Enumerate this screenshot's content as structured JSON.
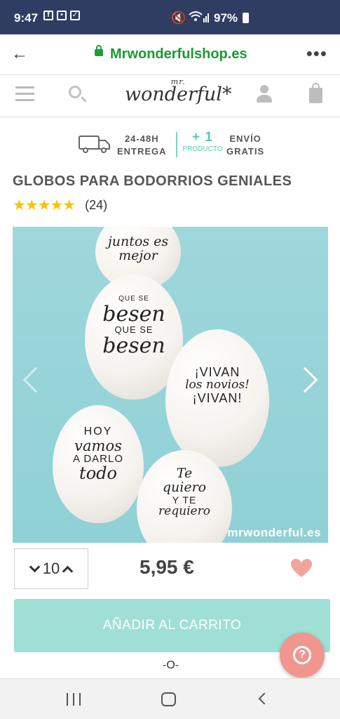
{
  "status_bar": {
    "time": "9:47",
    "battery": "97%"
  },
  "browser": {
    "url": "Mrwonderfulshop.es",
    "more": "•••"
  },
  "site": {
    "logo_top": "mr.",
    "logo_main": "wonderful*"
  },
  "shipping": {
    "delivery_line1": "24-48H",
    "delivery_line2": "ENTREGA",
    "plus": "+ 1",
    "plus_sub": "PRODUCTO",
    "free_line1": "ENVÍO",
    "free_line2": "GRATIS"
  },
  "product": {
    "title": "GLOBOS PARA BODORRIOS GENIALES",
    "stars": "★★★★★",
    "reviews": "(24)",
    "quantity": "10",
    "price": "5,95 €",
    "add_to_cart": "AÑADIR AL CARRITO",
    "separator": "-O-"
  },
  "image": {
    "watermark": "mrwonderful.es",
    "balloon1": "juntos es mejor",
    "balloon2_a": "QUE SE",
    "balloon2_b": "besen",
    "balloon2_c": "QUE SE",
    "balloon2_d": "besen",
    "balloon3_a": "¡VIVAN",
    "balloon3_b": "los novios!",
    "balloon3_c": "¡VIVAN!",
    "balloon4_a": "HOY",
    "balloon4_b": "vamos",
    "balloon4_c": "A DARLO",
    "balloon4_d": "todo",
    "balloon5_a": "Te",
    "balloon5_b": "quiero",
    "balloon5_c": "Y TE",
    "balloon5_d": "requiero"
  },
  "help": {
    "symbol": "?"
  },
  "colors": {
    "status_bar": "#2f3d63",
    "url_green": "#1a9a35",
    "accent_teal": "#9fdfd6",
    "heart": "#f0a49a",
    "star": "#f7c400"
  }
}
